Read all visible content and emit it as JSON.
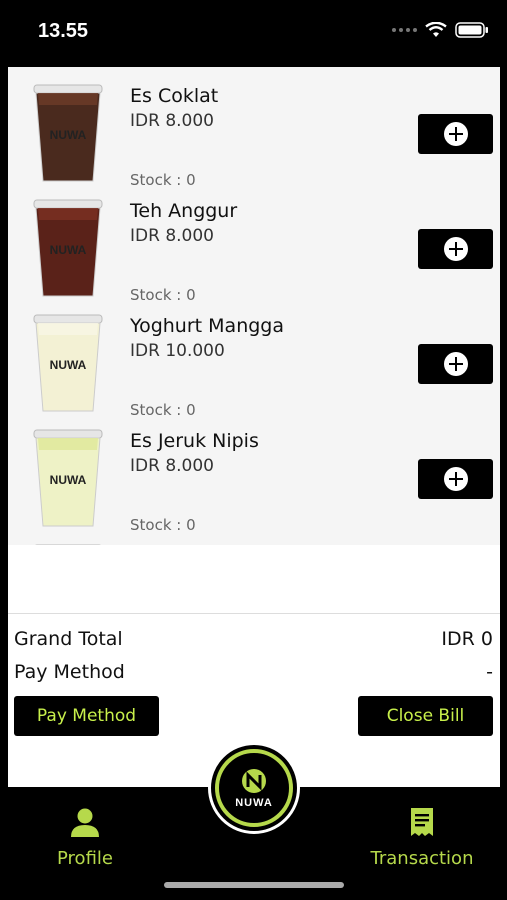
{
  "status": {
    "time": "13.55"
  },
  "products": [
    {
      "name": "Es Coklat",
      "price": "IDR 8.000",
      "stock": "Stock : 0",
      "cup_color": "#4a2a1e",
      "top_color": "#6b3b28"
    },
    {
      "name": "Teh Anggur",
      "price": "IDR 8.000",
      "stock": "Stock : 0",
      "cup_color": "#5a2219",
      "top_color": "#7a2f22"
    },
    {
      "name": "Yoghurt Mangga",
      "price": "IDR 10.000",
      "stock": "Stock : 0",
      "cup_color": "#f3f1d4",
      "top_color": "#f7f6e4"
    },
    {
      "name": "Es Jeruk Nipis",
      "price": "IDR 8.000",
      "stock": "Stock : 0",
      "cup_color": "#eef2c6",
      "top_color": "#dfe99a"
    }
  ],
  "cup_label": "NUWA",
  "summary": {
    "grand_total_label": "Grand Total",
    "grand_total_value": "IDR 0",
    "pay_method_label": "Pay Method",
    "pay_method_value": "-"
  },
  "buttons": {
    "pay_method": "Pay Method",
    "close_bill": "Close Bill"
  },
  "nav": {
    "profile": "Profile",
    "transaction": "Transaction",
    "brand": "NUWA"
  },
  "colors": {
    "accent": "#b6d94b",
    "background": "#000000"
  },
  "icons": [
    "wifi-icon",
    "battery-icon",
    "plus-icon",
    "profile-icon",
    "transaction-icon",
    "nuwa-logo"
  ]
}
